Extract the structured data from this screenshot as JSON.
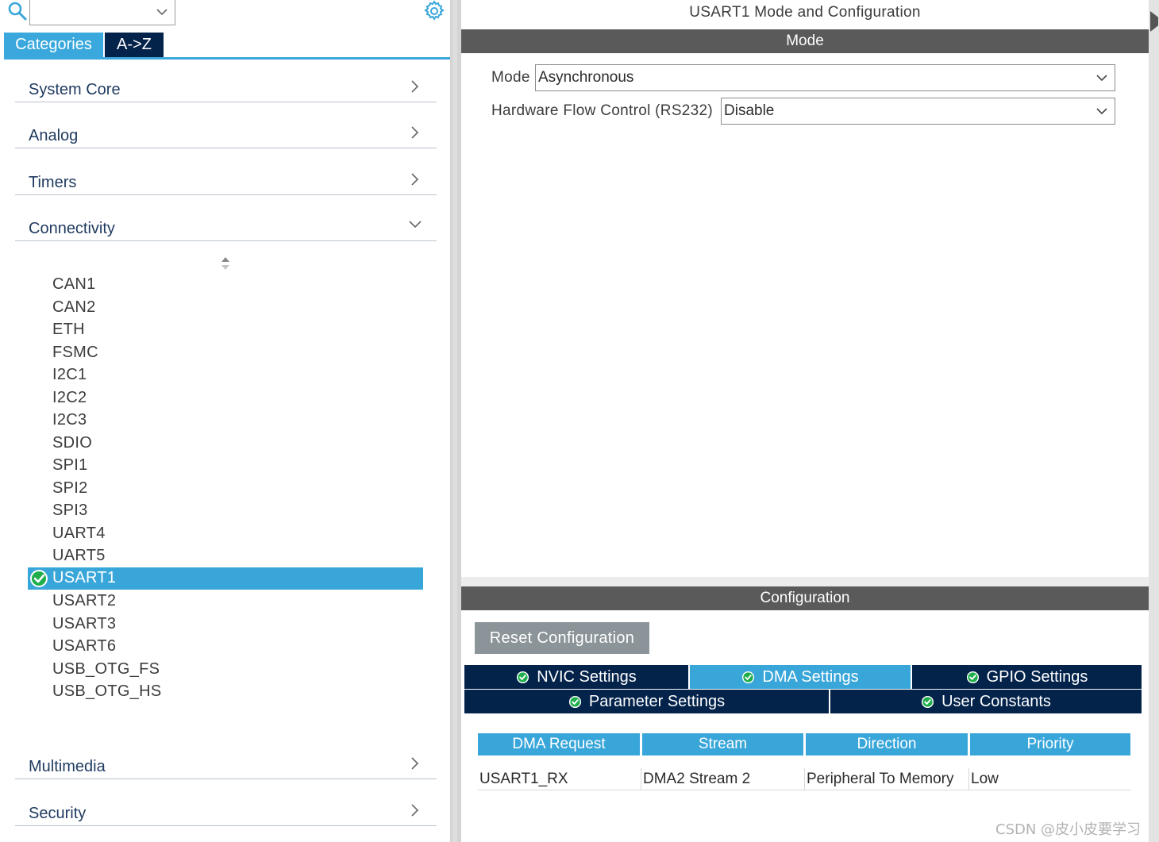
{
  "left": {
    "search": {
      "value": ""
    },
    "tabs": {
      "categories": "Categories",
      "az": "A->Z"
    },
    "categories": {
      "system_core": "System Core",
      "analog": "Analog",
      "timers": "Timers",
      "connectivity": "Connectivity",
      "multimedia": "Multimedia",
      "security": "Security"
    },
    "connectivity_items": [
      "CAN1",
      "CAN2",
      "ETH",
      "FSMC",
      "I2C1",
      "I2C2",
      "I2C3",
      "SDIO",
      "SPI1",
      "SPI2",
      "SPI3",
      "UART4",
      "UART5",
      "USART1",
      "USART2",
      "USART3",
      "USART6",
      "USB_OTG_FS",
      "USB_OTG_HS"
    ],
    "selected_item": "USART1"
  },
  "right": {
    "title": "USART1 Mode and Configuration",
    "mode_section": {
      "header": "Mode",
      "mode_label": "Mode",
      "mode_value": "Asynchronous",
      "flow_label": "Hardware Flow Control (RS232)",
      "flow_value": "Disable"
    },
    "config_section": {
      "header": "Configuration",
      "reset_button": "Reset Configuration",
      "tabs": {
        "nvic": "NVIC Settings",
        "dma": "DMA Settings",
        "gpio": "GPIO Settings",
        "parameter": "Parameter Settings",
        "user_constants": "User Constants"
      },
      "active_tab": "DMA Settings",
      "dma_table": {
        "headers": [
          "DMA Request",
          "Stream",
          "Direction",
          "Priority"
        ],
        "rows": [
          [
            "USART1_RX",
            "DMA2 Stream 2",
            "Peripheral To Memory",
            "Low"
          ]
        ]
      }
    }
  },
  "watermark": "CSDN @皮小皮要学习",
  "colors": {
    "accent": "#39a6da",
    "navy": "#03234b",
    "bar_gray": "#5a5a5a",
    "button_gray": "#8a9499",
    "check_green": "#1fae4b"
  }
}
